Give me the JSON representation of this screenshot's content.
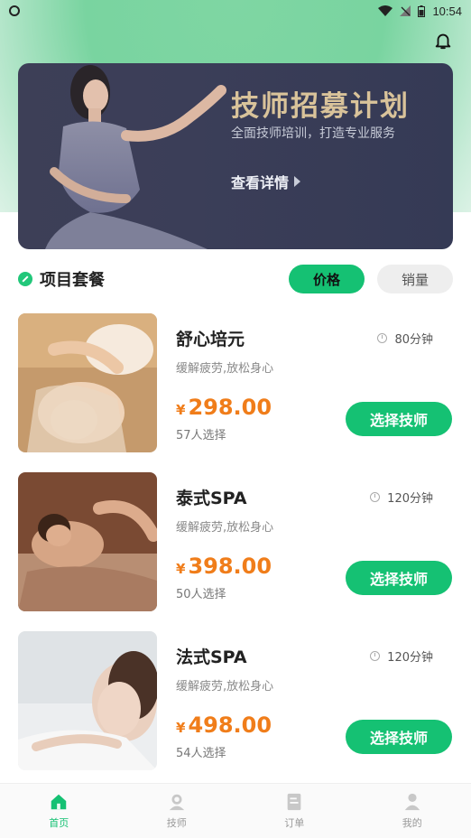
{
  "status_bar": {
    "time": "10:54"
  },
  "banner": {
    "title": "技师招募计划",
    "subtitle": "全面技师培训，打造专业服务",
    "more": "查看详情"
  },
  "section": {
    "title": "项目套餐",
    "tabs": [
      {
        "label": "价格",
        "active": true
      },
      {
        "label": "销量",
        "active": false
      }
    ]
  },
  "packages": [
    {
      "name": "舒心培元",
      "duration": "80分钟",
      "desc": "缓解疲劳,放松身心",
      "currency": "¥",
      "price": "298.00",
      "sold": "57人选择",
      "button": "选择技师"
    },
    {
      "name": "泰式SPA",
      "duration": "120分钟",
      "desc": "缓解疲劳,放松身心",
      "currency": "¥",
      "price": "398.00",
      "sold": "50人选择",
      "button": "选择技师"
    },
    {
      "name": "法式SPA",
      "duration": "120分钟",
      "desc": "缓解疲劳,放松身心",
      "currency": "¥",
      "price": "498.00",
      "sold": "54人选择",
      "button": "选择技师"
    }
  ],
  "tabbar": [
    {
      "label": "首页",
      "icon": "home-icon",
      "active": true
    },
    {
      "label": "技师",
      "icon": "technician-icon",
      "active": false
    },
    {
      "label": "订单",
      "icon": "order-icon",
      "active": false
    },
    {
      "label": "我的",
      "icon": "profile-icon",
      "active": false
    }
  ],
  "colors": {
    "accent": "#15c173",
    "price": "#f07d1a",
    "banner_title": "#d9c39a"
  }
}
